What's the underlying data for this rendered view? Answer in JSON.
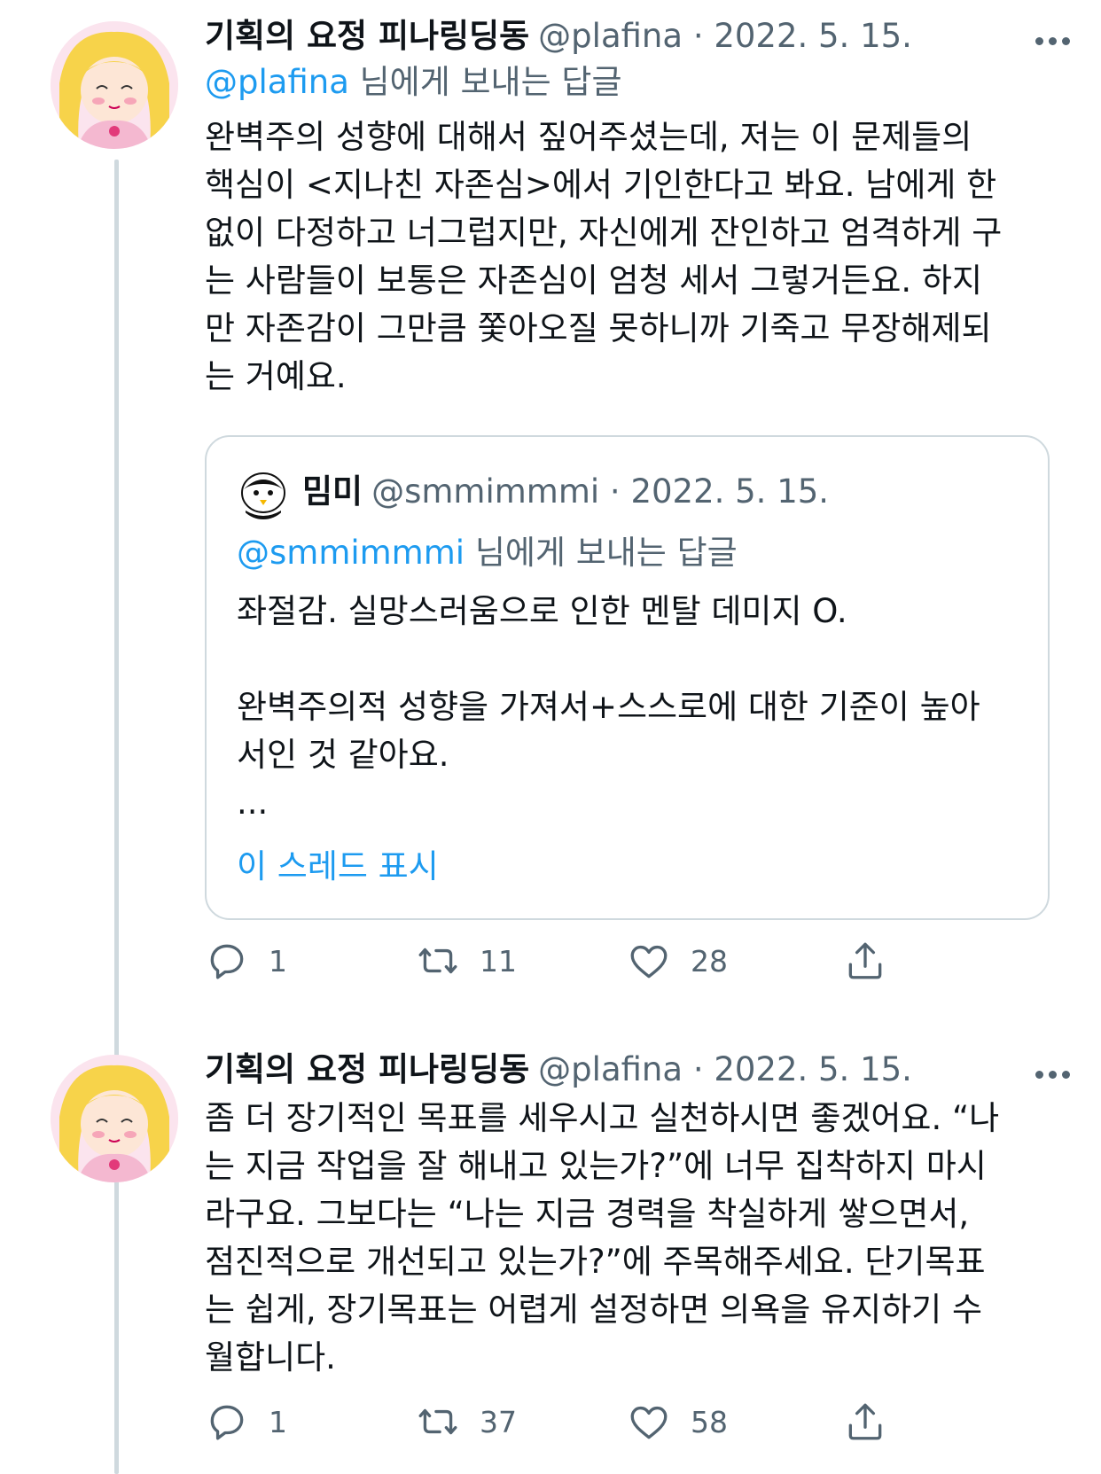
{
  "tweets": [
    {
      "author_name": "기획의 요정 피나링딩동",
      "handle": "@plafina",
      "date": "· 2022. 5. 15.",
      "reply_handle": "@plafina",
      "reply_suffix": " 님에게 보내는 답글",
      "text": "완벽주의 성향에 대해서 짚어주셨는데, 저는 이 문제들의\n핵심이 <지나친 자존심>에서 기인한다고 봐요. 남에게 한\n없이 다정하고 너그럽지만, 자신에게 잔인하고 엄격하게 구\n는 사람들이 보통은 자존심이 엄청 세서 그렇거든요. 하지\n만 자존감이 그만큼 쫓아오질 못하니까 기죽고 무장해제되\n는 거예요.",
      "quote": {
        "author_name": "밈미",
        "handle": "@smmimmmi",
        "date": "· 2022. 5. 15.",
        "reply_handle": "@smmimmmi",
        "reply_suffix": " 님에게 보내는 답글",
        "text": "좌절감. 실망스러움으로 인한 멘탈 데미지 O.\n\n완벽주의적 성향을 가져서+스스로에 대한 기준이 높아\n서인 것 같아요.\n...",
        "show_thread": "이 스레드 표시"
      },
      "actions": {
        "reply": "1",
        "retweet": "11",
        "like": "28"
      }
    },
    {
      "author_name": "기획의 요정 피나링딩동",
      "handle": "@plafina",
      "date": "· 2022. 5. 15.",
      "text": "좀 더 장기적인 목표를 세우시고 실천하시면 좋겠어요. “나\n는 지금 작업을 잘 해내고 있는가?”에 너무 집착하지 마시\n라구요. 그보다는 “나는 지금 경력을 착실하게 쌓으면서,\n점진적으로 개선되고 있는가?”에 주목해주세요. 단기목표\n는 쉽게, 장기목표는 어렵게 설정하면 의욕을 유지하기 수\n월합니다.",
      "actions": {
        "reply": "1",
        "retweet": "37",
        "like": "58"
      }
    }
  ],
  "icons": [
    "more-icon",
    "reply-icon",
    "retweet-icon",
    "like-icon",
    "share-icon"
  ],
  "colors": {
    "link": "#1d9bf0",
    "meta": "#536471",
    "text": "#0f1419",
    "border": "#cfd9de"
  }
}
